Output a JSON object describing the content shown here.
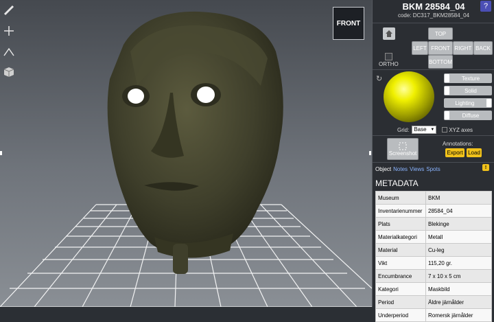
{
  "viewer": {
    "viewcube_label": "FRONT",
    "tools": [
      "ruler-icon",
      "crosshair-icon",
      "angle-icon",
      "cube-icon"
    ]
  },
  "header": {
    "title": "BKM 28584_04",
    "code": "code: DC317_BKM28584_04",
    "help_label": "?"
  },
  "views": {
    "top": "TOP",
    "left": "LEFT",
    "front": "FRONT",
    "right": "RIGHT",
    "back": "BACK",
    "bottom": "BOTTOM",
    "ortho": "ORTHO"
  },
  "render": {
    "texture": "Texture",
    "solid": "Solid",
    "lighting": "Lighting",
    "diffuse": "Diffuse",
    "grid_label": "Grid:",
    "grid_value": "Base",
    "xyz_label": "XYZ axes"
  },
  "actions": {
    "screenshot": "Screenshot",
    "annotations_label": "Annotations:",
    "export": "Export",
    "load": "Load"
  },
  "tabs": {
    "object": "Object",
    "notes": "Notes",
    "views": "Views",
    "spots": "Spots",
    "badge": "!"
  },
  "metadata": {
    "title": "METADATA",
    "rows": [
      {
        "key": "Museum",
        "value": "BKM"
      },
      {
        "key": "Inventarienummer",
        "value": "28584_04"
      },
      {
        "key": "Plats",
        "value": "Blekinge"
      },
      {
        "key": "Materialkategori",
        "value": "Metall"
      },
      {
        "key": "Material",
        "value": "Cu-leg"
      },
      {
        "key": "Vikt",
        "value": "115,20 gr."
      },
      {
        "key": "Encumbrance",
        "value": "7 x 10 x 5 cm"
      },
      {
        "key": "Kategori",
        "value": "Maskbild"
      },
      {
        "key": "Period",
        "value": "Äldre järnålder"
      },
      {
        "key": "Underperiod",
        "value": "Romersk järnålder"
      }
    ]
  },
  "colors": {
    "accent_yellow": "#f1c21b",
    "help_blue": "#4b4fb5",
    "panel_bg": "#2b2e33",
    "tab_link": "#8ab4ff"
  }
}
